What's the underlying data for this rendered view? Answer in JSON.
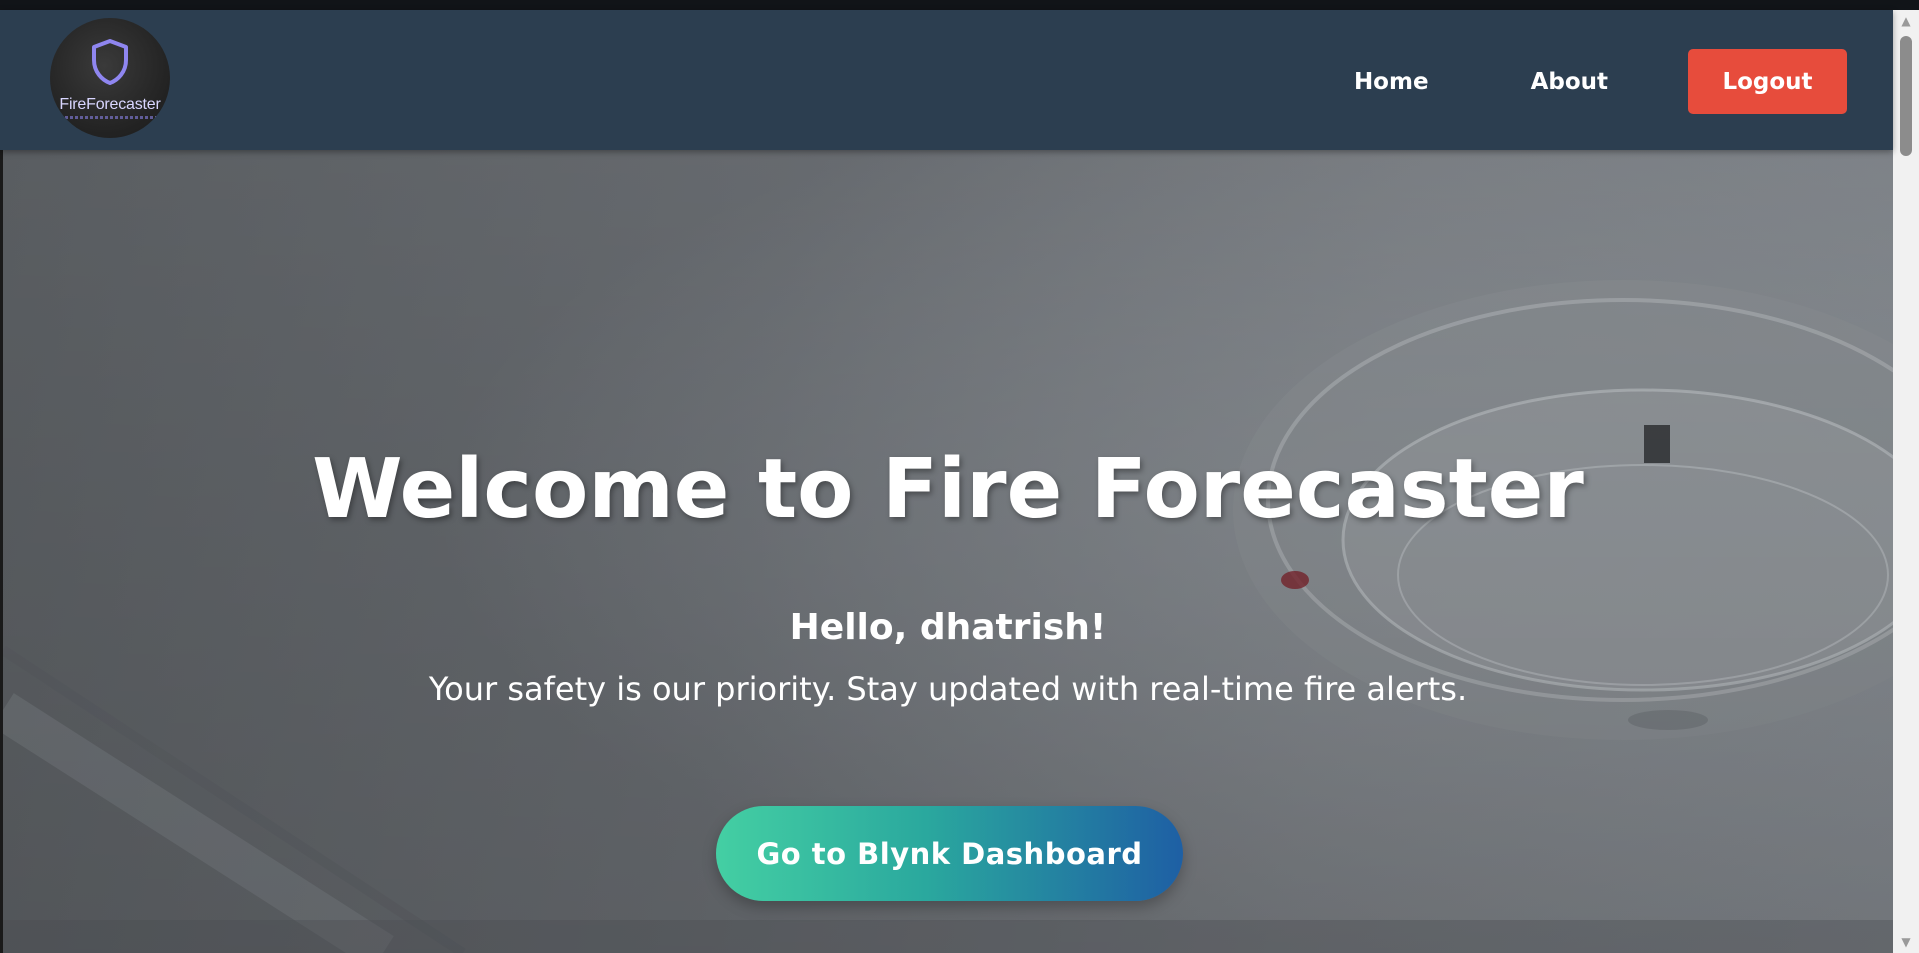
{
  "navbar": {
    "brand_text": "FireForecaster",
    "links": [
      {
        "label": "Home"
      },
      {
        "label": "About"
      }
    ],
    "logout_label": "Logout"
  },
  "hero": {
    "title": "Welcome to Fire Forecaster",
    "greeting": "Hello, dhatrish!",
    "subtitle": "Your safety is our priority. Stay updated with real-time fire alerts.",
    "cta_label": "Go to Blynk Dashboard"
  },
  "icons": {
    "logo": "shield-icon",
    "scroll_up": "triangle-up-icon",
    "scroll_down": "triangle-down-icon"
  },
  "colors": {
    "navbar_bg": "#2c3e50",
    "logout_bg": "#e74c3c",
    "cta_gradient_start": "#44cfa3",
    "cta_gradient_end": "#1e5fa4",
    "shield_accent": "#8f86f0"
  }
}
